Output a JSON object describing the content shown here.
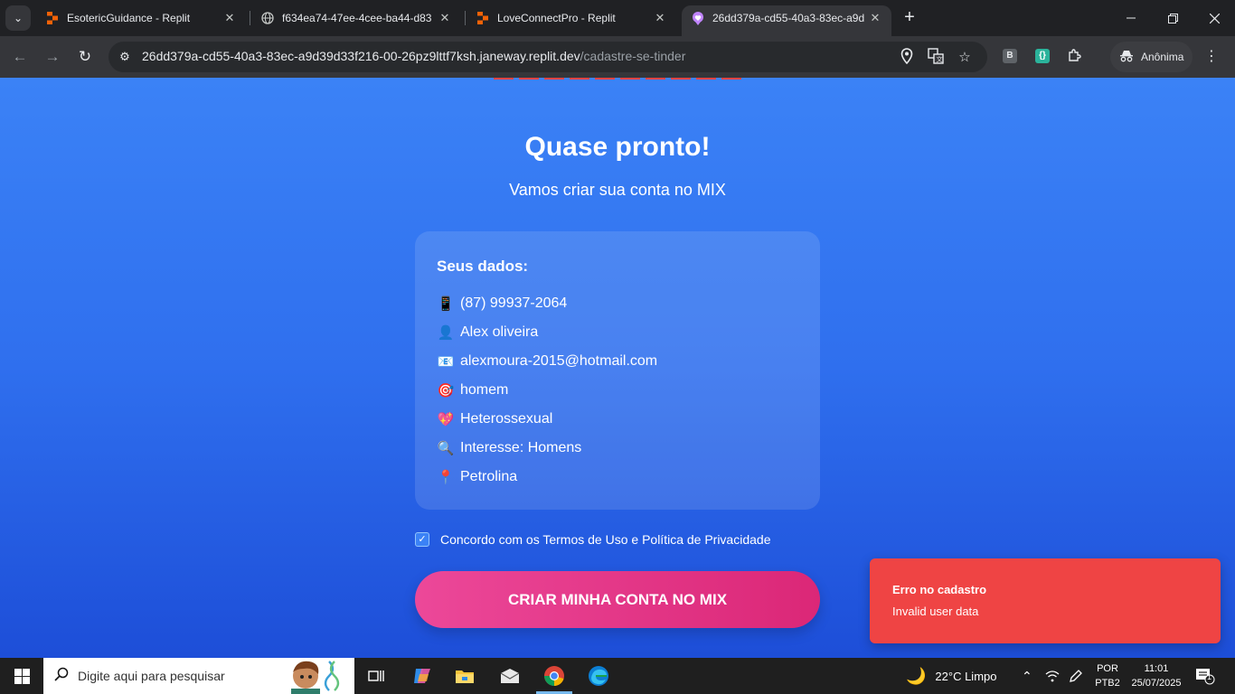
{
  "browser": {
    "tabs": [
      {
        "title": "EsotericGuidance - Replit",
        "active": false
      },
      {
        "title": "f634ea74-47ee-4cee-ba44-d83",
        "active": false
      },
      {
        "title": "LoveConnectPro - Replit",
        "active": false
      },
      {
        "title": "26dd379a-cd55-40a3-83ec-a9d",
        "active": true
      }
    ],
    "url_host": "26dd379a-cd55-40a3-83ec-a9d39d33f216-00-26pz9lttf7ksh.janeway.replit.dev",
    "url_path": "/cadastre-se-tinder",
    "profile_label": "Anônima",
    "extension_b_label": "B",
    "icons": {
      "tab_menu": "chevron-down-icon",
      "back": "back-arrow-icon",
      "forward": "forward-arrow-icon",
      "reload": "reload-icon",
      "site_info": "tune-icon",
      "location": "location-icon",
      "translate": "translate-icon",
      "bookmark": "star-icon",
      "extensions": "puzzle-icon",
      "incognito": "incognito-icon",
      "menu": "kebab-menu-icon"
    }
  },
  "page": {
    "heading": "Quase pronto!",
    "subheading": "Vamos criar sua conta no MIX",
    "card_title": "Seus dados:",
    "details": [
      {
        "icon": "📱",
        "text": "(87) 99937-2064"
      },
      {
        "icon": "👤",
        "text": "Alex oliveira"
      },
      {
        "icon": "📧",
        "text": "alexmoura-2015@hotmail.com"
      },
      {
        "icon": "🎯",
        "text": "homem"
      },
      {
        "icon": "💖",
        "text": "Heterossexual"
      },
      {
        "icon": "🔍",
        "text": "Interesse: Homens"
      },
      {
        "icon": "📍",
        "text": "Petrolina"
      }
    ],
    "terms_label": "Concordo com os Termos de Uso e Política de Privacidade",
    "terms_checked": true,
    "cta_label": "CRIAR MINHA CONTA NO MIX",
    "colors": {
      "background_top": "#3b82f6",
      "background_bottom": "#1d4ed8",
      "cta_start": "#ec4899",
      "cta_end": "#db2777",
      "toast": "#ef4444"
    }
  },
  "toast": {
    "title": "Erro no cadastro",
    "message": "Invalid user data"
  },
  "taskbar": {
    "search_placeholder": "Digite aqui para pesquisar",
    "weather": "22°C  Limpo",
    "lang_line1": "POR",
    "lang_line2": "PTB2",
    "time": "11:01",
    "date": "25/07/2025",
    "notification_count": "1"
  }
}
